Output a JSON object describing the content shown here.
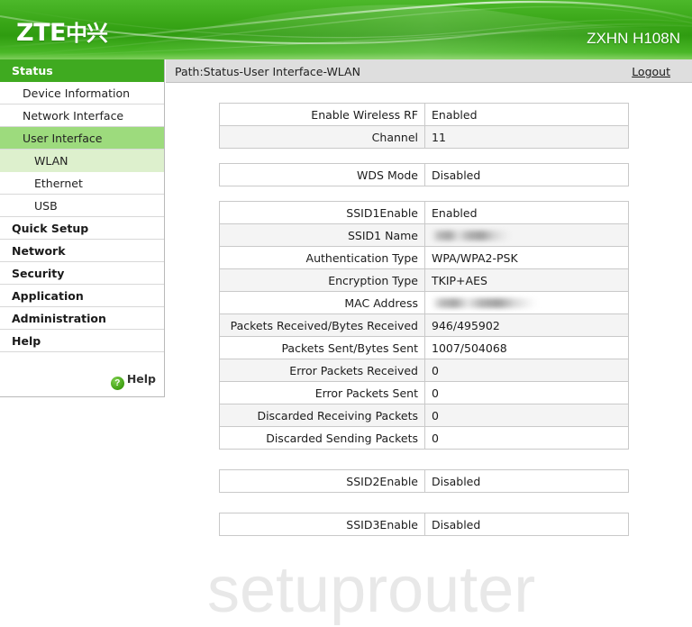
{
  "header": {
    "logo_latin": "ZTE",
    "logo_cn": "中兴",
    "model": "ZXHN H108N"
  },
  "sidebar": {
    "items": [
      {
        "label": "Status",
        "level": "top",
        "state": "active"
      },
      {
        "label": "Device Information",
        "level": "sub",
        "state": "normal"
      },
      {
        "label": "Network Interface",
        "level": "sub",
        "state": "normal"
      },
      {
        "label": "User Interface",
        "level": "sub",
        "state": "selected"
      },
      {
        "label": "WLAN",
        "level": "sub2",
        "state": "selected"
      },
      {
        "label": "Ethernet",
        "level": "sub2",
        "state": "normal"
      },
      {
        "label": "USB",
        "level": "sub2",
        "state": "normal"
      },
      {
        "label": "Quick Setup",
        "level": "top",
        "state": "normal"
      },
      {
        "label": "Network",
        "level": "top",
        "state": "normal"
      },
      {
        "label": "Security",
        "level": "top",
        "state": "normal"
      },
      {
        "label": "Application",
        "level": "top",
        "state": "normal"
      },
      {
        "label": "Administration",
        "level": "top",
        "state": "normal"
      },
      {
        "label": "Help",
        "level": "top",
        "state": "normal"
      }
    ],
    "help_link": {
      "icon": "question-mark-icon",
      "icon_glyph": "?",
      "label": "Help"
    }
  },
  "pathbar": {
    "path": "Path:Status-User Interface-WLAN",
    "logout": "Logout"
  },
  "watermark": "setuprouter",
  "tables": [
    {
      "name": "radio-table",
      "rows": [
        {
          "label": "Enable Wireless RF",
          "value": "Enabled",
          "redacted": false
        },
        {
          "label": "Channel",
          "value": "11",
          "redacted": false
        }
      ]
    },
    {
      "name": "wds-table",
      "rows": [
        {
          "label": "WDS Mode",
          "value": "Disabled",
          "redacted": false
        }
      ]
    },
    {
      "name": "ssid1-table",
      "rows": [
        {
          "label": "SSID1Enable",
          "value": "Enabled",
          "redacted": false
        },
        {
          "label": "SSID1 Name",
          "value": "",
          "redacted": "ssid"
        },
        {
          "label": "Authentication Type",
          "value": "WPA/WPA2-PSK",
          "redacted": false
        },
        {
          "label": "Encryption Type",
          "value": "TKIP+AES",
          "redacted": false
        },
        {
          "label": "MAC Address",
          "value": "",
          "redacted": "mac"
        },
        {
          "label": "Packets Received/Bytes Received",
          "value": "946/495902",
          "redacted": false
        },
        {
          "label": "Packets Sent/Bytes Sent",
          "value": "1007/504068",
          "redacted": false
        },
        {
          "label": "Error Packets Received",
          "value": "0",
          "redacted": false
        },
        {
          "label": "Error Packets Sent",
          "value": "0",
          "redacted": false
        },
        {
          "label": "Discarded Receiving Packets",
          "value": "0",
          "redacted": false
        },
        {
          "label": "Discarded Sending Packets",
          "value": "0",
          "redacted": false
        }
      ]
    },
    {
      "name": "ssid2-table",
      "rows": [
        {
          "label": "SSID2Enable",
          "value": "Disabled",
          "redacted": false
        }
      ]
    },
    {
      "name": "ssid3-table",
      "rows": [
        {
          "label": "SSID3Enable",
          "value": "Disabled",
          "redacted": false
        }
      ]
    }
  ],
  "colors": {
    "brand_green": "#3faa20",
    "header_green": "#39a617",
    "selected_green": "#9ddb7d",
    "subselected_green": "#ddf0cd",
    "pathbar_gray": "#dedede",
    "row_alt_gray": "#f4f4f4"
  }
}
